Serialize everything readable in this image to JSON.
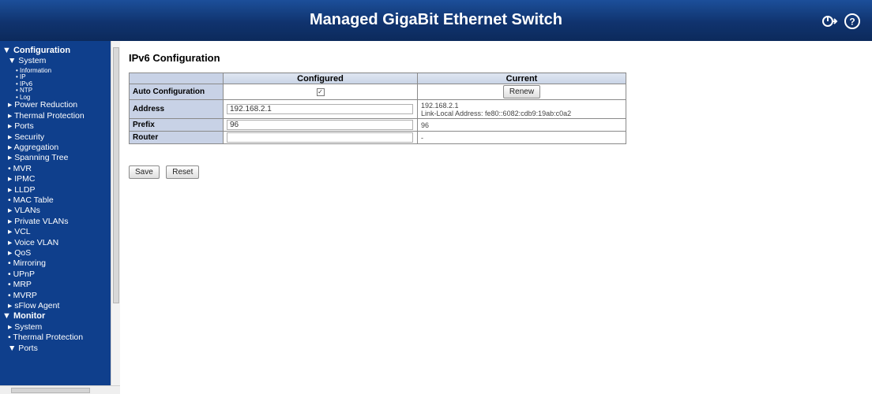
{
  "header": {
    "title": "Managed GigaBit Ethernet Switch"
  },
  "sidebar": {
    "items": [
      {
        "label": "▼ Configuration",
        "level": 0
      },
      {
        "label": "▼ System",
        "level": 1
      },
      {
        "label": "• Information",
        "level": 2
      },
      {
        "label": "• IP",
        "level": 2
      },
      {
        "label": "• IPv6",
        "level": 2
      },
      {
        "label": "• NTP",
        "level": 2
      },
      {
        "label": "• Log",
        "level": 2
      },
      {
        "label": "▸ Power Reduction",
        "level": 1
      },
      {
        "label": "▸ Thermal Protection",
        "level": 1
      },
      {
        "label": "▸ Ports",
        "level": 1
      },
      {
        "label": "▸ Security",
        "level": 1
      },
      {
        "label": "▸ Aggregation",
        "level": 1
      },
      {
        "label": "▸ Spanning Tree",
        "level": 1
      },
      {
        "label": "• MVR",
        "level": 1
      },
      {
        "label": "▸ IPMC",
        "level": 1
      },
      {
        "label": "▸ LLDP",
        "level": 1
      },
      {
        "label": "• MAC Table",
        "level": 1
      },
      {
        "label": "▸ VLANs",
        "level": 1
      },
      {
        "label": "▸ Private VLANs",
        "level": 1
      },
      {
        "label": "▸ VCL",
        "level": 1
      },
      {
        "label": "▸ Voice VLAN",
        "level": 1
      },
      {
        "label": "▸ QoS",
        "level": 1
      },
      {
        "label": "• Mirroring",
        "level": 1
      },
      {
        "label": "• UPnP",
        "level": 1
      },
      {
        "label": "• MRP",
        "level": 1
      },
      {
        "label": "• MVRP",
        "level": 1
      },
      {
        "label": "▸ sFlow Agent",
        "level": 1
      },
      {
        "label": "▼ Monitor",
        "level": 0
      },
      {
        "label": "▸ System",
        "level": 1
      },
      {
        "label": "• Thermal Protection",
        "level": 1
      },
      {
        "label": "▼ Ports",
        "level": 1
      }
    ]
  },
  "page": {
    "title": "IPv6 Configuration"
  },
  "table": {
    "columns": {
      "configured": "Configured",
      "current": "Current"
    },
    "rows": {
      "auto": {
        "label": "Auto Configuration",
        "checked": true,
        "renew": "Renew"
      },
      "address": {
        "label": "Address",
        "value": "192.168.2.1",
        "current_line1": "192.168.2.1",
        "current_line2": "Link-Local Address: fe80::6082:cdb9:19ab:c0a2"
      },
      "prefix": {
        "label": "Prefix",
        "value": "96",
        "current": "96"
      },
      "router": {
        "label": "Router",
        "value": "",
        "current": "-"
      }
    }
  },
  "actions": {
    "save": "Save",
    "reset": "Reset"
  },
  "colors": {
    "header": "#10336e",
    "sidebar": "#0f3f8c",
    "table_label": "#c8d2e6"
  }
}
